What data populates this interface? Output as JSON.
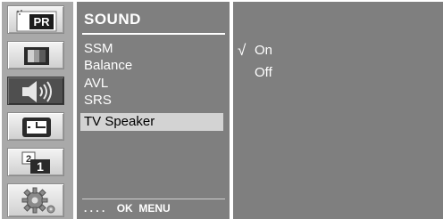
{
  "left_icons": [
    {
      "name": "picture-icon",
      "label": "PR",
      "active": false
    },
    {
      "name": "screen-icon",
      "active": false
    },
    {
      "name": "speaker-icon",
      "active": true
    },
    {
      "name": "clock-icon",
      "active": false
    },
    {
      "name": "channel-icon",
      "label": "1",
      "active": false
    },
    {
      "name": "gear-icon",
      "active": false
    }
  ],
  "menu": {
    "title": "SOUND",
    "items": [
      "SSM",
      "Balance",
      "AVL",
      "SRS",
      "TV Speaker"
    ],
    "selected_index": 4,
    "footer": {
      "dots": ". . . .",
      "ok": "OK",
      "menu": "MENU"
    }
  },
  "options": {
    "check_mark": "√",
    "items": [
      "On",
      "Off"
    ],
    "checked_index": 0
  },
  "colors": {
    "panel": "#7f7f7f",
    "icon_column": "#a9a9a9",
    "selection": "#d3d3d3",
    "text": "#ffffff"
  }
}
